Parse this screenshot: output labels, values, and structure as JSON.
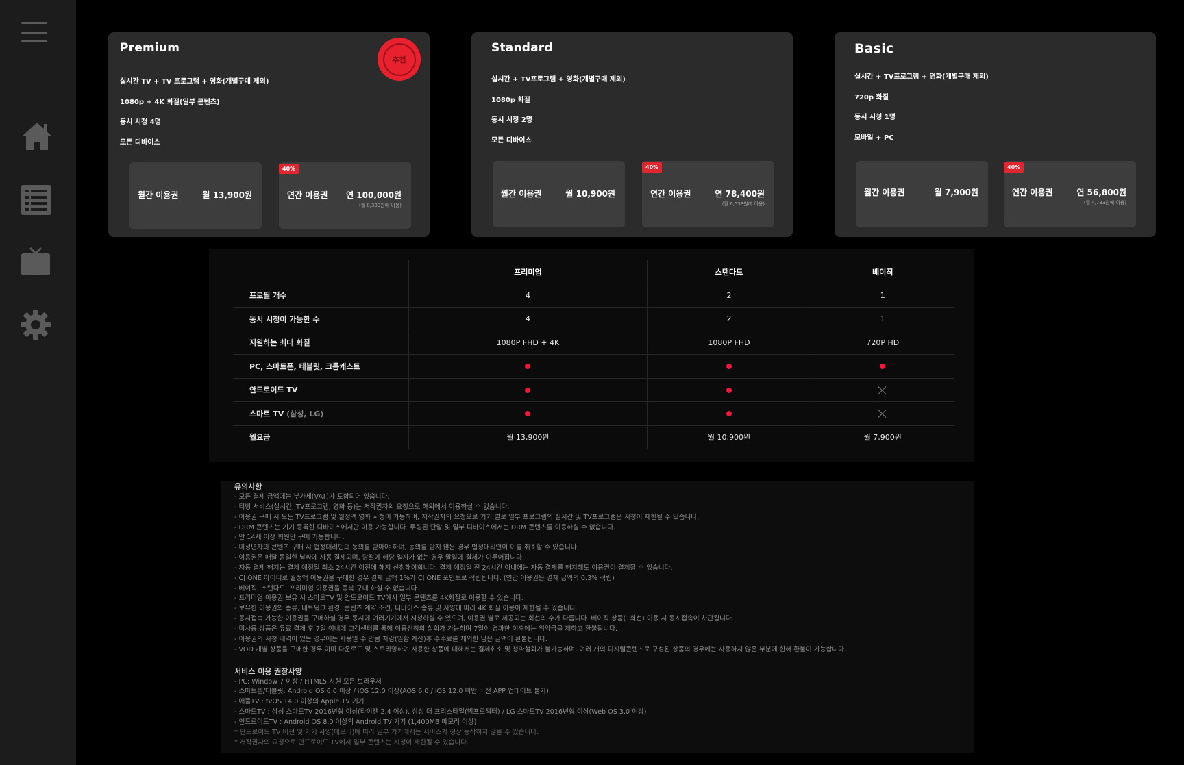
{
  "sidebar": {
    "items": [
      {
        "name": "menu-icon"
      },
      {
        "name": "home-icon"
      },
      {
        "name": "list-icon"
      },
      {
        "name": "tv-icon"
      },
      {
        "name": "settings-icon"
      }
    ]
  },
  "plans": {
    "premium": {
      "title": "Premium",
      "badge": "추천",
      "features": [
        "실시간 TV + TV 프로그램 + 영화(개별구매 제외)",
        "1080p + 4K 화질(일부 콘텐츠)",
        "동시 시청 4명",
        "모든 디바이스"
      ],
      "monthly_label": "월간 이용권",
      "monthly_price": "월 13,900원",
      "annual_badge": "40%",
      "annual_label": "연간 이용권",
      "annual_price": "연 100,000원",
      "annual_sub": "(월 8,333원에 이용)"
    },
    "standard": {
      "title": "Standard",
      "features": [
        "실시간 + TV프로그램 + 영화(개별구매 제외)",
        "1080p 화질",
        "동시 시청 2명",
        "모든 디바이스"
      ],
      "monthly_label": "월간 이용권",
      "monthly_price": "월 10,900원",
      "annual_badge": "40%",
      "annual_label": "연간 이용권",
      "annual_price": "연 78,400원",
      "annual_sub": "(월 6,533원에 이용)"
    },
    "basic": {
      "title": "Basic",
      "features": [
        "실시간 + TV프로그램 + 영화(개별구매 제외)",
        "720p 화질",
        "동시 시청 1명",
        "모바일 + PC"
      ],
      "monthly_label": "월간 이용권",
      "monthly_price": "월 7,900원",
      "annual_badge": "40%",
      "annual_label": "연간 이용권",
      "annual_price": "연 56,800원",
      "annual_sub": "(월 4,733원에 이용)"
    }
  },
  "table": {
    "headers": [
      "",
      "프리미엄",
      "스탠다드",
      "베이직"
    ],
    "rows": [
      {
        "label": "프로필 개수",
        "values": [
          "4",
          "2",
          "1"
        ]
      },
      {
        "label": "동시 시청이 가능한 수",
        "values": [
          "4",
          "2",
          "1"
        ]
      },
      {
        "label": "지원하는 최대 화질",
        "values": [
          "1080P FHD + 4K",
          "1080P FHD",
          "720P HD"
        ]
      },
      {
        "label": "PC, 스마트폰, 태블릿, 크롬캐스트",
        "values": [
          "dot",
          "dot",
          "dot"
        ]
      },
      {
        "label": "안드로이드 TV",
        "values": [
          "dot",
          "dot",
          "x"
        ]
      },
      {
        "label": "스마트 TV",
        "label_note": "(삼성, LG)",
        "values": [
          "dot",
          "dot",
          "x"
        ]
      },
      {
        "label": "월요금",
        "values": [
          "월 13,900원",
          "월 10,900원",
          "월 7,900원"
        ]
      }
    ],
    "dot_color": "#f0163c"
  },
  "notes": {
    "caution_title": "유의사항",
    "caution": [
      "- 모든 결제 금액에는 부가세(VAT)가 포함되어 있습니다.",
      "- 티빙 서비스(실시간, TV프로그램, 영화 등)는 저작권자의 요청으로 해외에서 이용하실 수 없습니다.",
      "- 이용권 구매 시 모든 TV프로그램 및 월정액 영화 시청이 가능하며, 저작권자의 요청으로 기기 별로 일부 프로그램의 실시간 및 TV프로그램은 시청이 제한될 수 있습니다.",
      "- DRM 콘텐츠는 기기 등록한 디바이스에서만 이용 가능합니다. 루팅된 단말 및 일부 디바이스에서는 DRM 콘텐츠를 이용하실 수 없습니다.",
      "- 만 14세 이상 회원만 구매 가능합니다.",
      "- 미성년자의 콘텐츠 구매 시 법정대리인의 동의를 받아야 하며, 동의를 받지 않은 경우 법정대리인이 이를 취소할 수 있습니다.",
      "- 이용권은 매달 동일한 날짜에 자동 결제되며, 당월에 해당 일자가 없는 경우 말일에 결제가 이루어집니다.",
      "- 자동 결제 해지는 결제 예정일 최소 24시간 이전에 해지 신청해야합니다. 결제 예정일 전 24시간 이내에는 자동 결제를 해지해도 이용권이 결제될 수 있습니다.",
      "- CJ ONE 아이디로 월정액 이용권을 구매한 경우 결제 금액 1%가 CJ ONE 포인트로 적립됩니다. (연간 이용권은 결제 금액의 0.3% 적립)",
      "- 베이직, 스탠다드, 프리미엄 이용권을 중복 구매 하실 수 없습니다.",
      "- 프리미엄 이용권 보유 시 스마트TV 및 안드로이드 TV에서 일부 콘텐츠를 4K화질로 이용할 수 있습니다.",
      "- 보유한 이용권의 종류, 네트워크 환경, 콘텐츠 계약 조건, 디바이스 종류 및 사양에 따라 4K 화질 이용이 제한될 수 있습니다.",
      "- 동시접속 가능한 이용권을 구매하실 경우 동시에 여러기기에서 시청하실 수 있으며, 이용권 별로 제공되는 회선의 수가 다릅니다. 베이직 상품(1회선) 이용 시 동시접속이 차단됩니다.",
      "- 미사용 상품은 유료 결제 후 7일 이내에 고객센터를 통해 이용신청의 철회가 가능하며 7일이 경과한 이후에는 위약금을 제하고 환불됩니다.",
      "- 이용권의 시청 내역이 있는 경우에는 사용일 수 만큼 차감(일할 계산)후 수수료를 제외한 남은 금액이 환불됩니다.",
      "- VOD 개별 상품을 구매한 경우 이미 다운로드 및 스트리밍하여 사용한 상품에 대해서는 결제취소 및 청약철회가 불가능하며, 여러 개의 디지털콘텐츠로 구성된 상품의 경우에는 사용하지 않은 부분에 한해 환불이 가능합니다."
    ],
    "recommend_title": "서비스 이용 권장사양",
    "recommend": [
      "- PC: Window 7 이상 / HTML5 지원 모든 브라우저",
      "- 스마트폰/태블릿: Android OS 6.0 이상 / iOS 12.0 이상(AOS 6.0 / iOS 12.0 미만 버전 APP 업데이트 불가)",
      "- 애플TV : tvOS 14.0 이상의 Apple TV 기기",
      "- 스마트TV : 삼성 스마트TV 2016년형 이상(타이젠 2.4 이상), 삼성 더 프리스타일(빔프로젝터) / LG 스마트TV 2016년형 이상(Web OS 3.0 이상)",
      "- 안드로이드TV : Android OS 8.0 이상의 Android TV 기기 (1,400MB 메모리 이상)"
    ],
    "footnotes": [
      "* 안드로이드 TV 버전 및 기기 사양(메모리)에 따라 일부 기기에서는 서비스가 정상 동작하지 않을 수 있습니다.",
      "* 저작권자의 요청으로 안드로이드 TV에서 일부 콘텐츠는 시청이 제한될 수 있습니다."
    ]
  },
  "colors": {
    "accent": "#e1262f",
    "card_bg": "#2b2b2b",
    "price_bg": "#3d3d3d",
    "sidebar_bg": "#1c1c1c"
  }
}
